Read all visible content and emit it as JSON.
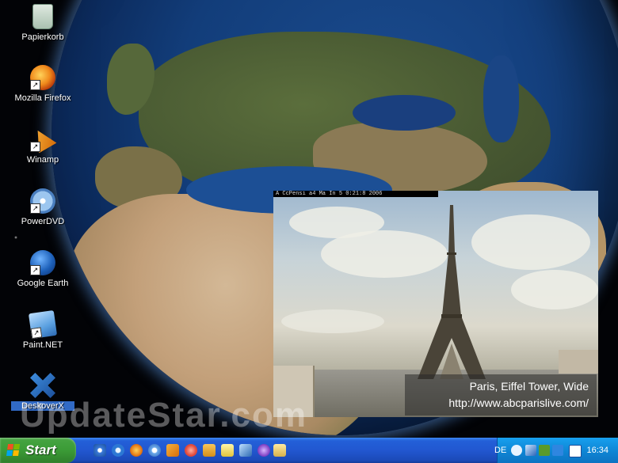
{
  "desktop": {
    "icons": [
      {
        "label": "Papierkorb"
      },
      {
        "label": "Mozilla Firefox"
      },
      {
        "label": "Winamp"
      },
      {
        "label": "PowerDVD"
      },
      {
        "label": "Google Earth"
      },
      {
        "label": "Paint.NET"
      },
      {
        "label": "DeskoverX"
      }
    ]
  },
  "webcam": {
    "header": "A  CcPensi a4 Ma  In  5  0:21:8  2006",
    "caption_line1": "Paris, Eiffel Tower, Wide",
    "caption_line2": "http://www.abcparislive.com/"
  },
  "watermark": "UpdateStar.com",
  "taskbar": {
    "start_label": "Start",
    "language": "DE",
    "clock": "16:34"
  },
  "colors": {
    "taskbar": "#2257d0",
    "start_button": "#3b9b36",
    "tray": "#0f87d6",
    "selection": "#316ac5"
  }
}
